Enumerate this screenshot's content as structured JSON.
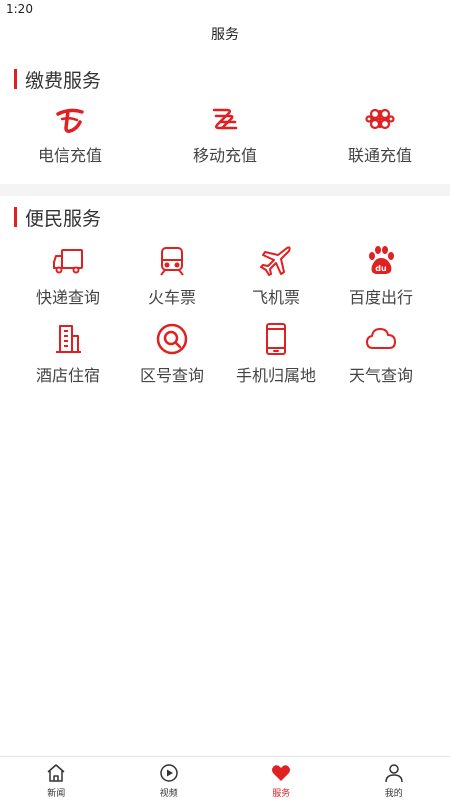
{
  "status": {
    "time": "1:20"
  },
  "header": {
    "title": "服务"
  },
  "payment": {
    "title": "缴费服务",
    "items": [
      {
        "label": "电信充值",
        "icon": "china-telecom-icon"
      },
      {
        "label": "移动充值",
        "icon": "china-mobile-icon"
      },
      {
        "label": "联通充值",
        "icon": "china-unicom-icon"
      }
    ]
  },
  "convenience": {
    "title": "便民服务",
    "items": [
      {
        "label": "快递查询",
        "icon": "truck-icon"
      },
      {
        "label": "火车票",
        "icon": "train-icon"
      },
      {
        "label": "飞机票",
        "icon": "airplane-icon"
      },
      {
        "label": "百度出行",
        "icon": "baidu-paw-icon"
      },
      {
        "label": "酒店住宿",
        "icon": "building-icon"
      },
      {
        "label": "区号查询",
        "icon": "search-icon"
      },
      {
        "label": "手机归属地",
        "icon": "phone-icon"
      },
      {
        "label": "天气查询",
        "icon": "cloud-icon"
      }
    ]
  },
  "tabs": [
    {
      "label": "新闻",
      "icon": "home-icon"
    },
    {
      "label": "视频",
      "icon": "play-icon"
    },
    {
      "label": "服务",
      "icon": "heart-icon",
      "active": true
    },
    {
      "label": "我的",
      "icon": "user-icon"
    }
  ],
  "colors": {
    "accent": "#e02121",
    "divider": "#f4f4f4"
  }
}
